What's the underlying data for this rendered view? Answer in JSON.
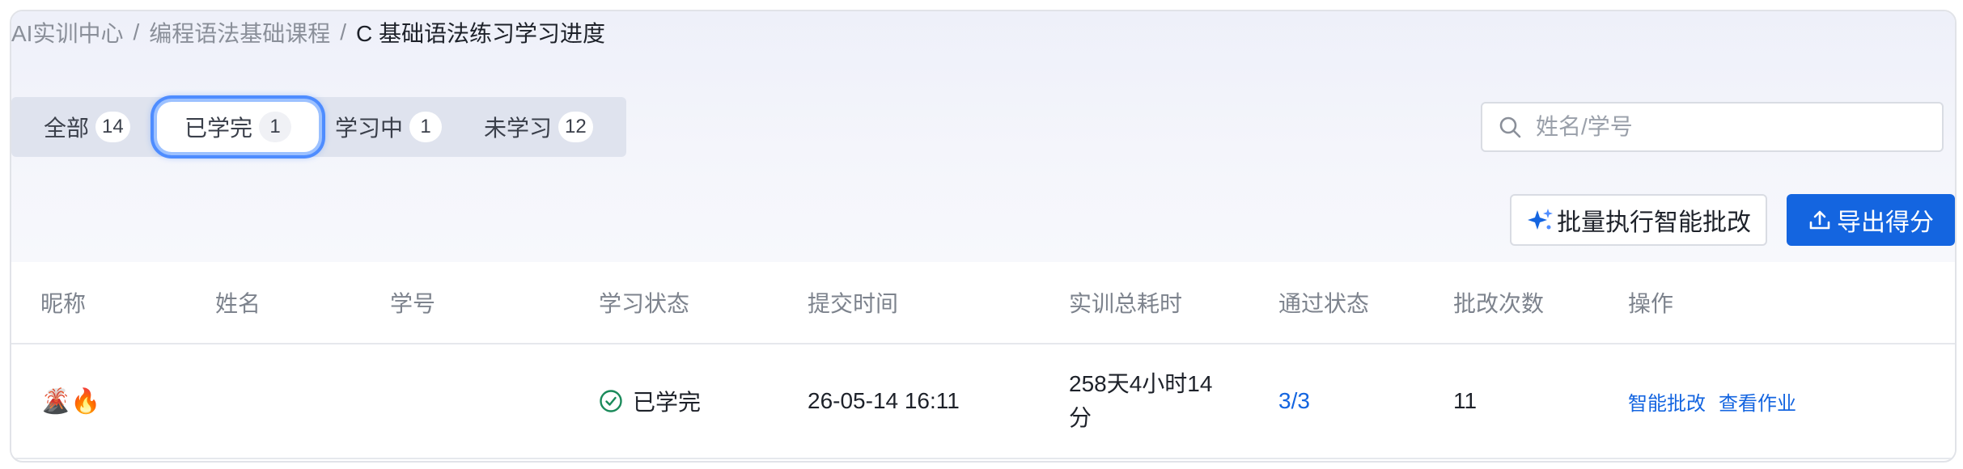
{
  "breadcrumb": {
    "items": [
      "AI实训中心",
      "编程语法基础课程",
      "C 基础语法练习学习进度"
    ],
    "separator": "/"
  },
  "tabs": [
    {
      "label": "全部",
      "count": "14",
      "active": false
    },
    {
      "label": "已学完",
      "count": "1",
      "active": true
    },
    {
      "label": "学习中",
      "count": "1",
      "active": false
    },
    {
      "label": "未学习",
      "count": "12",
      "active": false
    }
  ],
  "search": {
    "placeholder": "姓名/学号",
    "value": "",
    "icon": "search-icon"
  },
  "toolbar": {
    "batch_label": "批量执行智能批改",
    "batch_icon": "sparkle-icon",
    "export_label": "导出得分",
    "export_icon": "upload-icon"
  },
  "table": {
    "headers": [
      "昵称",
      "姓名",
      "学号",
      "学习状态",
      "提交时间",
      "实训总耗时",
      "通过状态",
      "批改次数",
      "操作"
    ],
    "rows": [
      {
        "nickname": "🌋🔥",
        "name": "",
        "student_id": "",
        "status": "已学完",
        "submit_time": "26-05-14 16:11",
        "duration": "258天4小时14分",
        "pass_status": "3/3",
        "review_count": "11",
        "actions": [
          "智能批改",
          "查看作业"
        ]
      }
    ]
  },
  "colors": {
    "primary": "#1465e0",
    "success": "#1a8a5a",
    "tab_bg": "#dfe3ee",
    "active_glow": "#4f8dff"
  }
}
